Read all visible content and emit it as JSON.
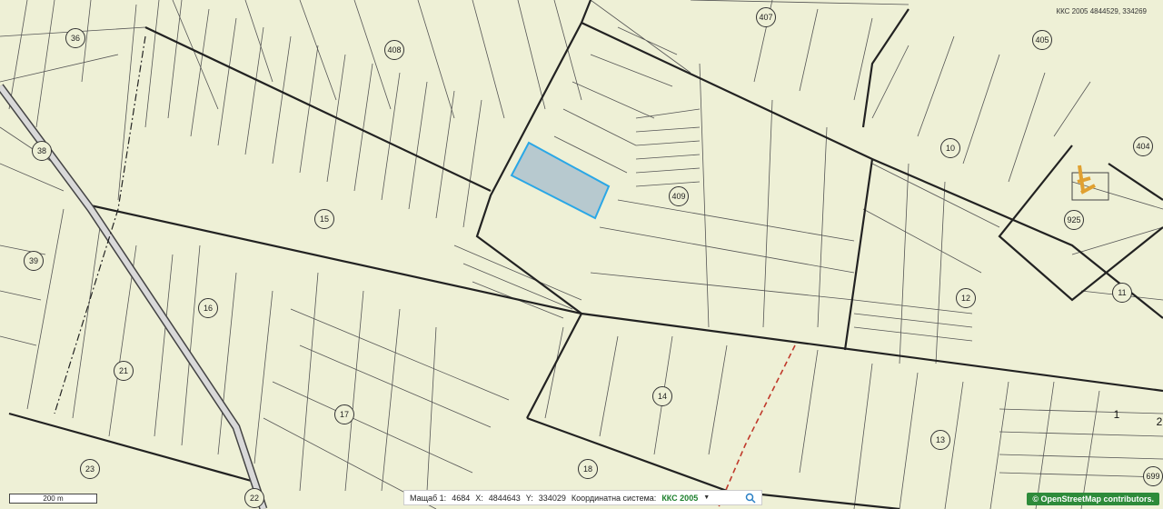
{
  "map": {
    "coord_readout": "ККС 2005 4844529, 334269",
    "scale_bar_label": "200 m",
    "parcel_numbers": [
      "36",
      "408",
      "407",
      "405",
      "38",
      "404",
      "10",
      "409",
      "925",
      "15",
      "39",
      "12",
      "11",
      "16",
      "21",
      "14",
      "17",
      "13",
      "23",
      "18",
      "22",
      "1",
      "2",
      "699"
    ],
    "highlight_color": "#b7c9cf",
    "highlight_border": "#2aa7e6",
    "base_color": "#eef0d6"
  },
  "statusbar": {
    "scale_label": "Мащаб 1:",
    "scale_value": "4684",
    "x_label": "X:",
    "x_value": "4844643",
    "y_label": "Y:",
    "y_value": "334029",
    "crs_label": "Координатна система:",
    "crs_value": "ККС 2005"
  },
  "attribution": "© OpenStreetMap contributors."
}
